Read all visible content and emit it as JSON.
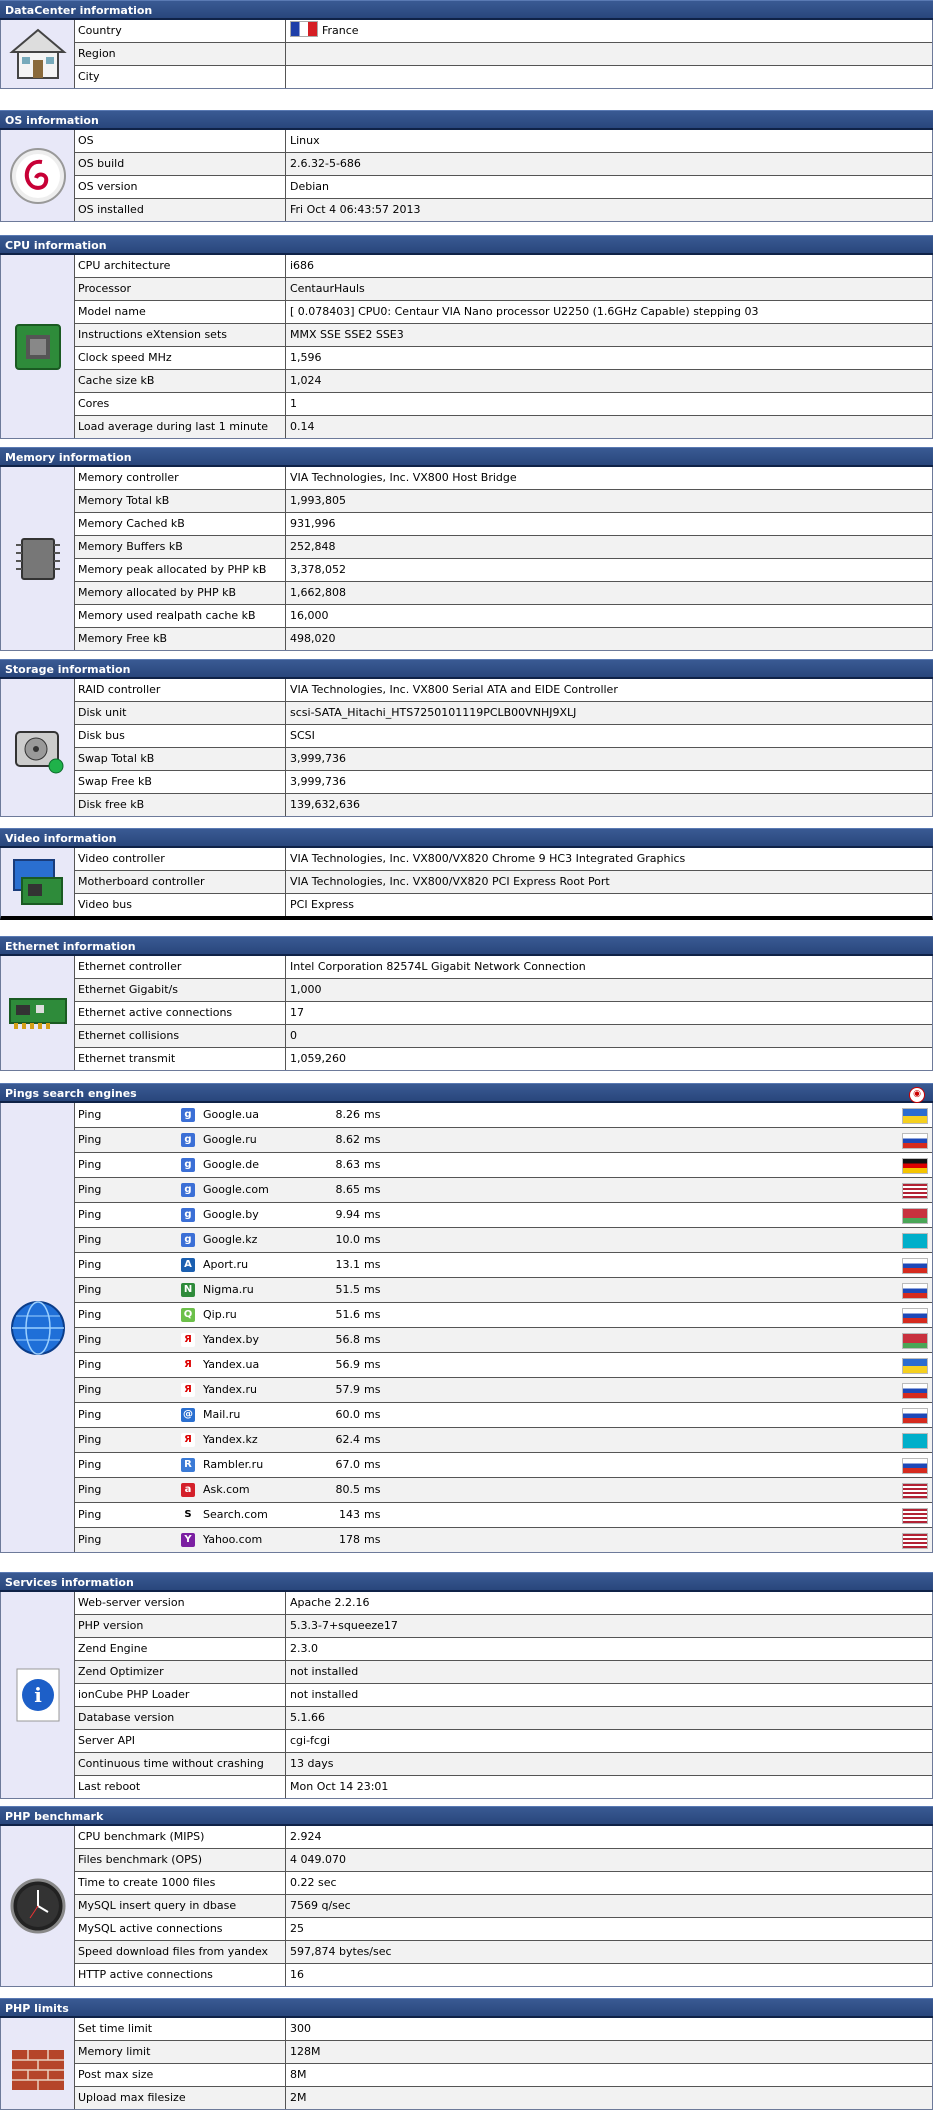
{
  "datacenter": {
    "title": "DataCenter information",
    "rows": [
      {
        "label": "Country",
        "value": "France"
      },
      {
        "label": "Region",
        "value": ""
      },
      {
        "label": "City",
        "value": ""
      }
    ]
  },
  "os": {
    "title": "OS information",
    "rows": [
      {
        "label": "OS",
        "value": "Linux"
      },
      {
        "label": "OS build",
        "value": "2.6.32-5-686"
      },
      {
        "label": "OS version",
        "value": "Debian"
      },
      {
        "label": "OS installed",
        "value": "Fri Oct 4 06:43:57 2013"
      }
    ]
  },
  "cpu": {
    "title": "CPU information",
    "rows": [
      {
        "label": "CPU architecture",
        "value": "i686"
      },
      {
        "label": "Processor",
        "value": "CentaurHauls"
      },
      {
        "label": "Model name",
        "value": "[ 0.078403] CPU0: Centaur VIA Nano processor U2250 (1.6GHz Capable) stepping 03"
      },
      {
        "label": "Instructions eXtension sets",
        "value": "MMX SSE SSE2 SSE3"
      },
      {
        "label": "Clock speed MHz",
        "value": "1,596"
      },
      {
        "label": "Cache size kB",
        "value": "1,024"
      },
      {
        "label": "Cores",
        "value": "1"
      },
      {
        "label": "Load average during last 1 minute",
        "value": "0.14"
      }
    ]
  },
  "memory": {
    "title": "Memory information",
    "rows": [
      {
        "label": "Memory controller",
        "value": "VIA Technologies, Inc. VX800 Host Bridge"
      },
      {
        "label": "Memory Total kB",
        "value": "1,993,805"
      },
      {
        "label": "Memory Cached kB",
        "value": "931,996"
      },
      {
        "label": "Memory Buffers kB",
        "value": "252,848"
      },
      {
        "label": "Memory peak allocated by PHP kB",
        "value": "3,378,052"
      },
      {
        "label": "Memory allocated by PHP kB",
        "value": "1,662,808"
      },
      {
        "label": "Memory used realpath cache kB",
        "value": "16,000"
      },
      {
        "label": "Memory Free kB",
        "value": "498,020"
      }
    ]
  },
  "storage": {
    "title": "Storage information",
    "rows": [
      {
        "label": "RAID controller",
        "value": "VIA Technologies, Inc. VX800 Serial ATA and EIDE Controller"
      },
      {
        "label": "Disk unit",
        "value": "scsi-SATA_Hitachi_HTS7250101119PCLB00VNHJ9XLJ"
      },
      {
        "label": "Disk bus",
        "value": "SCSI"
      },
      {
        "label": "Swap Total kB",
        "value": "3,999,736"
      },
      {
        "label": "Swap Free kB",
        "value": "3,999,736"
      },
      {
        "label": "Disk free kB",
        "value": "139,632,636"
      }
    ]
  },
  "video": {
    "title": "Video information",
    "rows": [
      {
        "label": "Video controller",
        "value": "VIA Technologies, Inc. VX800/VX820 Chrome 9 HC3 Integrated Graphics"
      },
      {
        "label": "Motherboard controller",
        "value": "VIA Technologies, Inc. VX800/VX820 PCI Express Root Port"
      },
      {
        "label": "Video bus",
        "value": "PCI Express"
      }
    ]
  },
  "ethernet": {
    "title": "Ethernet information",
    "rows": [
      {
        "label": "Ethernet controller",
        "value": "Intel Corporation 82574L Gigabit Network Connection"
      },
      {
        "label": "Ethernet Gigabit/s",
        "value": "1,000"
      },
      {
        "label": "Ethernet active connections",
        "value": "17"
      },
      {
        "label": "Ethernet collisions",
        "value": "0"
      },
      {
        "label": "Ethernet transmit",
        "value": "1,059,260"
      }
    ]
  },
  "pings": {
    "title": "Pings search engines",
    "rows": [
      {
        "label": "Ping",
        "engine": "Google.ua",
        "time": "8.26",
        "unit": "ms",
        "icon": "google-icon",
        "flag": "UA"
      },
      {
        "label": "Ping",
        "engine": "Google.ru",
        "time": "8.62",
        "unit": "ms",
        "icon": "google-icon",
        "flag": "RU"
      },
      {
        "label": "Ping",
        "engine": "Google.de",
        "time": "8.63",
        "unit": "ms",
        "icon": "google-icon",
        "flag": "DE"
      },
      {
        "label": "Ping",
        "engine": "Google.com",
        "time": "8.65",
        "unit": "ms",
        "icon": "google-icon",
        "flag": "US"
      },
      {
        "label": "Ping",
        "engine": "Google.by",
        "time": "9.94",
        "unit": "ms",
        "icon": "google-icon",
        "flag": "BY"
      },
      {
        "label": "Ping",
        "engine": "Google.kz",
        "time": "10.0",
        "unit": "ms",
        "icon": "google-icon",
        "flag": "KZ"
      },
      {
        "label": "Ping",
        "engine": "Aport.ru",
        "time": "13.1",
        "unit": "ms",
        "icon": "aport-icon",
        "flag": "RU"
      },
      {
        "label": "Ping",
        "engine": "Nigma.ru",
        "time": "51.5",
        "unit": "ms",
        "icon": "nigma-icon",
        "flag": "RU"
      },
      {
        "label": "Ping",
        "engine": "Qip.ru",
        "time": "51.6",
        "unit": "ms",
        "icon": "qip-icon",
        "flag": "RU"
      },
      {
        "label": "Ping",
        "engine": "Yandex.by",
        "time": "56.8",
        "unit": "ms",
        "icon": "yandex-icon",
        "flag": "BY"
      },
      {
        "label": "Ping",
        "engine": "Yandex.ua",
        "time": "56.9",
        "unit": "ms",
        "icon": "yandex-icon",
        "flag": "UA"
      },
      {
        "label": "Ping",
        "engine": "Yandex.ru",
        "time": "57.9",
        "unit": "ms",
        "icon": "yandex-icon",
        "flag": "RU"
      },
      {
        "label": "Ping",
        "engine": "Mail.ru",
        "time": "60.0",
        "unit": "ms",
        "icon": "mail-icon",
        "flag": "RU"
      },
      {
        "label": "Ping",
        "engine": "Yandex.kz",
        "time": "62.4",
        "unit": "ms",
        "icon": "yandex-icon",
        "flag": "KZ"
      },
      {
        "label": "Ping",
        "engine": "Rambler.ru",
        "time": "67.0",
        "unit": "ms",
        "icon": "rambler-icon",
        "flag": "RU"
      },
      {
        "label": "Ping",
        "engine": "Ask.com",
        "time": "80.5",
        "unit": "ms",
        "icon": "ask-icon",
        "flag": "US"
      },
      {
        "label": "Ping",
        "engine": "Search.com",
        "time": "143",
        "unit": "ms",
        "icon": "search-com-icon",
        "flag": "US"
      },
      {
        "label": "Ping",
        "engine": "Yahoo.com",
        "time": "178",
        "unit": "ms",
        "icon": "yahoo-icon",
        "flag": "US"
      }
    ]
  },
  "services": {
    "title": "Services information",
    "rows": [
      {
        "label": "Web-server version",
        "value": "Apache 2.2.16"
      },
      {
        "label": "PHP version",
        "value": "5.3.3-7+squeeze17"
      },
      {
        "label": "Zend Engine",
        "value": "2.3.0"
      },
      {
        "label": "Zend Optimizer",
        "value": "not installed"
      },
      {
        "label": "ionCube PHP Loader",
        "value": "not installed"
      },
      {
        "label": "Database version",
        "value": "5.1.66"
      },
      {
        "label": "Server API",
        "value": "cgi-fcgi"
      },
      {
        "label": "Continuous time without crashing",
        "value": "13 days"
      },
      {
        "label": "Last reboot",
        "value": "Mon Oct 14 23:01"
      }
    ]
  },
  "benchmark": {
    "title": "PHP benchmark",
    "rows": [
      {
        "label": "CPU benchmark (MIPS)",
        "value": "2.924"
      },
      {
        "label": "Files benchmark (OPS)",
        "value": "4 049.070"
      },
      {
        "label": "Time to create 1000 files",
        "value": "0.22 sec"
      },
      {
        "label": "MySQL insert query in dbase",
        "value": "7569 q/sec"
      },
      {
        "label": "MySQL active connections",
        "value": "25"
      },
      {
        "label": "Speed download files from yandex",
        "value": "597,874 bytes/sec"
      },
      {
        "label": "HTTP active connections",
        "value": "16"
      }
    ]
  },
  "limits": {
    "title": "PHP limits",
    "rows": [
      {
        "label": "Set time limit",
        "value": "300"
      },
      {
        "label": "Memory limit",
        "value": "128M"
      },
      {
        "label": "Post max size",
        "value": "8M"
      },
      {
        "label": "Upload max filesize",
        "value": "2M"
      }
    ]
  }
}
